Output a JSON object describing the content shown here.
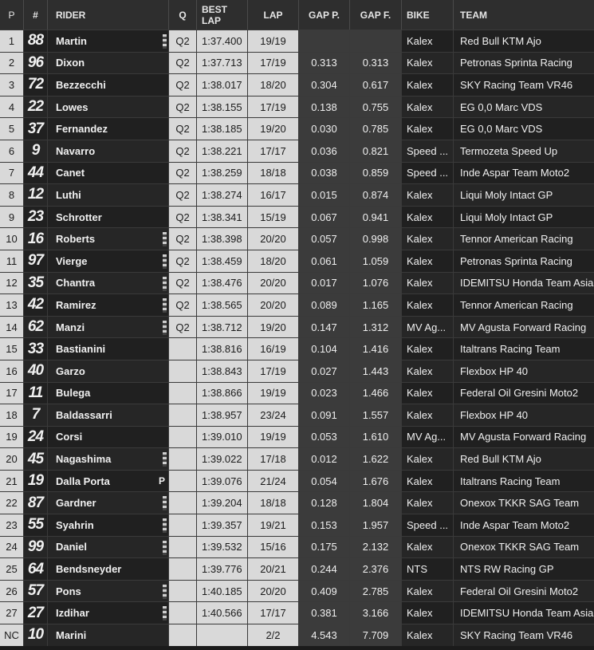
{
  "headers": {
    "p": "P",
    "num": "#",
    "rider": "RIDER",
    "q": "Q",
    "best": "BEST LAP",
    "lap": "LAP",
    "gapp": "GAP P.",
    "gapf": "GAP F.",
    "bike": "BIKE",
    "team": "TEAM"
  },
  "rows": [
    {
      "p": "1",
      "num": "88",
      "rider": "Martin",
      "flag": true,
      "mark": "",
      "q": "Q2",
      "best": "1:37.400",
      "lap": "19/19",
      "gapp": "",
      "gapf": "",
      "bike": "Kalex",
      "team": "Red Bull KTM Ajo"
    },
    {
      "p": "2",
      "num": "96",
      "rider": "Dixon",
      "flag": false,
      "mark": "",
      "q": "Q2",
      "best": "1:37.713",
      "lap": "17/19",
      "gapp": "0.313",
      "gapf": "0.313",
      "bike": "Kalex",
      "team": "Petronas Sprinta Racing"
    },
    {
      "p": "3",
      "num": "72",
      "rider": "Bezzecchi",
      "flag": false,
      "mark": "",
      "q": "Q2",
      "best": "1:38.017",
      "lap": "18/20",
      "gapp": "0.304",
      "gapf": "0.617",
      "bike": "Kalex",
      "team": "SKY Racing Team VR46"
    },
    {
      "p": "4",
      "num": "22",
      "rider": "Lowes",
      "flag": false,
      "mark": "",
      "q": "Q2",
      "best": "1:38.155",
      "lap": "17/19",
      "gapp": "0.138",
      "gapf": "0.755",
      "bike": "Kalex",
      "team": "EG 0,0 Marc VDS"
    },
    {
      "p": "5",
      "num": "37",
      "rider": "Fernandez",
      "flag": false,
      "mark": "",
      "q": "Q2",
      "best": "1:38.185",
      "lap": "19/20",
      "gapp": "0.030",
      "gapf": "0.785",
      "bike": "Kalex",
      "team": "EG 0,0 Marc VDS"
    },
    {
      "p": "6",
      "num": "9",
      "rider": "Navarro",
      "flag": false,
      "mark": "",
      "q": "Q2",
      "best": "1:38.221",
      "lap": "17/17",
      "gapp": "0.036",
      "gapf": "0.821",
      "bike": "Speed ...",
      "team": "Termozeta Speed Up"
    },
    {
      "p": "7",
      "num": "44",
      "rider": "Canet",
      "flag": false,
      "mark": "",
      "q": "Q2",
      "best": "1:38.259",
      "lap": "18/18",
      "gapp": "0.038",
      "gapf": "0.859",
      "bike": "Speed ...",
      "team": "Inde Aspar Team Moto2"
    },
    {
      "p": "8",
      "num": "12",
      "rider": "Luthi",
      "flag": false,
      "mark": "",
      "q": "Q2",
      "best": "1:38.274",
      "lap": "16/17",
      "gapp": "0.015",
      "gapf": "0.874",
      "bike": "Kalex",
      "team": "Liqui Moly Intact GP"
    },
    {
      "p": "9",
      "num": "23",
      "rider": "Schrotter",
      "flag": false,
      "mark": "",
      "q": "Q2",
      "best": "1:38.341",
      "lap": "15/19",
      "gapp": "0.067",
      "gapf": "0.941",
      "bike": "Kalex",
      "team": "Liqui Moly Intact GP"
    },
    {
      "p": "10",
      "num": "16",
      "rider": "Roberts",
      "flag": true,
      "mark": "",
      "q": "Q2",
      "best": "1:38.398",
      "lap": "20/20",
      "gapp": "0.057",
      "gapf": "0.998",
      "bike": "Kalex",
      "team": "Tennor American Racing"
    },
    {
      "p": "11",
      "num": "97",
      "rider": "Vierge",
      "flag": true,
      "mark": "",
      "q": "Q2",
      "best": "1:38.459",
      "lap": "18/20",
      "gapp": "0.061",
      "gapf": "1.059",
      "bike": "Kalex",
      "team": "Petronas Sprinta Racing"
    },
    {
      "p": "12",
      "num": "35",
      "rider": "Chantra",
      "flag": true,
      "mark": "",
      "q": "Q2",
      "best": "1:38.476",
      "lap": "20/20",
      "gapp": "0.017",
      "gapf": "1.076",
      "bike": "Kalex",
      "team": "IDEMITSU Honda Team Asia"
    },
    {
      "p": "13",
      "num": "42",
      "rider": "Ramirez",
      "flag": true,
      "mark": "",
      "q": "Q2",
      "best": "1:38.565",
      "lap": "20/20",
      "gapp": "0.089",
      "gapf": "1.165",
      "bike": "Kalex",
      "team": "Tennor American Racing"
    },
    {
      "p": "14",
      "num": "62",
      "rider": "Manzi",
      "flag": true,
      "mark": "",
      "q": "Q2",
      "best": "1:38.712",
      "lap": "19/20",
      "gapp": "0.147",
      "gapf": "1.312",
      "bike": "MV Ag...",
      "team": "MV Agusta Forward Racing"
    },
    {
      "p": "15",
      "num": "33",
      "rider": "Bastianini",
      "flag": false,
      "mark": "",
      "q": "",
      "best": "1:38.816",
      "lap": "16/19",
      "gapp": "0.104",
      "gapf": "1.416",
      "bike": "Kalex",
      "team": "Italtrans Racing Team"
    },
    {
      "p": "16",
      "num": "40",
      "rider": "Garzo",
      "flag": false,
      "mark": "",
      "q": "",
      "best": "1:38.843",
      "lap": "17/19",
      "gapp": "0.027",
      "gapf": "1.443",
      "bike": "Kalex",
      "team": "Flexbox HP 40"
    },
    {
      "p": "17",
      "num": "11",
      "rider": "Bulega",
      "flag": false,
      "mark": "",
      "q": "",
      "best": "1:38.866",
      "lap": "19/19",
      "gapp": "0.023",
      "gapf": "1.466",
      "bike": "Kalex",
      "team": "Federal Oil Gresini Moto2"
    },
    {
      "p": "18",
      "num": "7",
      "rider": "Baldassarri",
      "flag": false,
      "mark": "",
      "q": "",
      "best": "1:38.957",
      "lap": "23/24",
      "gapp": "0.091",
      "gapf": "1.557",
      "bike": "Kalex",
      "team": "Flexbox HP 40"
    },
    {
      "p": "19",
      "num": "24",
      "rider": "Corsi",
      "flag": false,
      "mark": "",
      "q": "",
      "best": "1:39.010",
      "lap": "19/19",
      "gapp": "0.053",
      "gapf": "1.610",
      "bike": "MV Ag...",
      "team": "MV Agusta Forward Racing"
    },
    {
      "p": "20",
      "num": "45",
      "rider": "Nagashima",
      "flag": true,
      "mark": "",
      "q": "",
      "best": "1:39.022",
      "lap": "17/18",
      "gapp": "0.012",
      "gapf": "1.622",
      "bike": "Kalex",
      "team": "Red Bull KTM Ajo"
    },
    {
      "p": "21",
      "num": "19",
      "rider": "Dalla Porta",
      "flag": false,
      "mark": "P",
      "q": "",
      "best": "1:39.076",
      "lap": "21/24",
      "gapp": "0.054",
      "gapf": "1.676",
      "bike": "Kalex",
      "team": "Italtrans Racing Team"
    },
    {
      "p": "22",
      "num": "87",
      "rider": "Gardner",
      "flag": true,
      "mark": "",
      "q": "",
      "best": "1:39.204",
      "lap": "18/18",
      "gapp": "0.128",
      "gapf": "1.804",
      "bike": "Kalex",
      "team": "Onexox TKKR SAG Team"
    },
    {
      "p": "23",
      "num": "55",
      "rider": "Syahrin",
      "flag": true,
      "mark": "",
      "q": "",
      "best": "1:39.357",
      "lap": "19/21",
      "gapp": "0.153",
      "gapf": "1.957",
      "bike": "Speed ...",
      "team": "Inde Aspar Team Moto2"
    },
    {
      "p": "24",
      "num": "99",
      "rider": "Daniel",
      "flag": true,
      "mark": "",
      "q": "",
      "best": "1:39.532",
      "lap": "15/16",
      "gapp": "0.175",
      "gapf": "2.132",
      "bike": "Kalex",
      "team": "Onexox TKKR SAG Team"
    },
    {
      "p": "25",
      "num": "64",
      "rider": "Bendsneyder",
      "flag": false,
      "mark": "",
      "q": "",
      "best": "1:39.776",
      "lap": "20/21",
      "gapp": "0.244",
      "gapf": "2.376",
      "bike": "NTS",
      "team": "NTS RW Racing GP"
    },
    {
      "p": "26",
      "num": "57",
      "rider": "Pons",
      "flag": true,
      "mark": "",
      "q": "",
      "best": "1:40.185",
      "lap": "20/20",
      "gapp": "0.409",
      "gapf": "2.785",
      "bike": "Kalex",
      "team": "Federal Oil Gresini Moto2"
    },
    {
      "p": "27",
      "num": "27",
      "rider": "Izdihar",
      "flag": true,
      "mark": "",
      "q": "",
      "best": "1:40.566",
      "lap": "17/17",
      "gapp": "0.381",
      "gapf": "3.166",
      "bike": "Kalex",
      "team": "IDEMITSU Honda Team Asia"
    },
    {
      "p": "NC",
      "num": "10",
      "rider": "Marini",
      "flag": false,
      "mark": "",
      "q": "",
      "best": "",
      "lap": "2/2",
      "gapp": "4.543",
      "gapf": "7.709",
      "bike": "Kalex",
      "team": "SKY Racing Team VR46"
    }
  ]
}
